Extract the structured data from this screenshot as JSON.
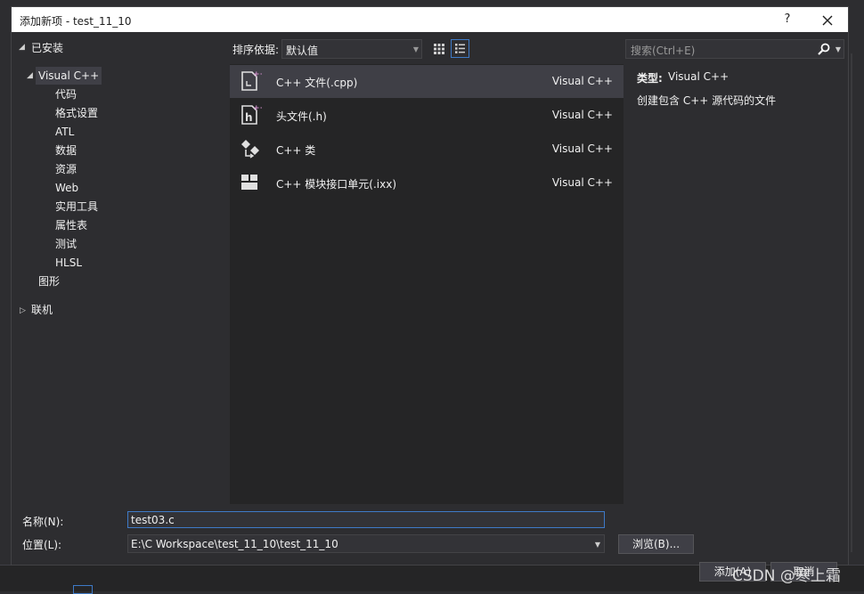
{
  "window": {
    "title": "添加新项 - test_11_10",
    "help_label": "?",
    "close_label": "✕"
  },
  "tree": {
    "installed": "已安装",
    "visual_cpp": "Visual C++",
    "children": [
      "代码",
      "格式设置",
      "ATL",
      "数据",
      "资源",
      "Web",
      "实用工具",
      "属性表",
      "测试",
      "HLSL"
    ],
    "graphics": "图形",
    "online": "联机"
  },
  "toolbar": {
    "sort_label": "排序依据:",
    "sort_value": "默认值"
  },
  "templates": [
    {
      "name": "C++ 文件(.cpp)",
      "lang": "Visual C++",
      "icon": "cpp-file-icon"
    },
    {
      "name": "头文件(.h)",
      "lang": "Visual C++",
      "icon": "header-file-icon"
    },
    {
      "name": "C++ 类",
      "lang": "Visual C++",
      "icon": "cpp-class-icon"
    },
    {
      "name": "C++ 模块接口单元(.ixx)",
      "lang": "Visual C++",
      "icon": "module-unit-icon"
    }
  ],
  "search": {
    "placeholder": "搜索(Ctrl+E)"
  },
  "details": {
    "type_label": "类型:",
    "type_value": "Visual C++",
    "description": "创建包含 C++ 源代码的文件"
  },
  "form": {
    "name_label": "名称(N):",
    "name_value": "test03.c",
    "location_label": "位置(L):",
    "location_value": "E:\\C Workspace\\test_11_10\\test_11_10",
    "browse_label": "浏览(B)...",
    "add_label": "添加(A)",
    "cancel_label": "取消"
  },
  "watermark": "CSDN @寒上霜",
  "colors": {
    "accent": "#3e7ac7",
    "background": "#2d2d30",
    "panel": "#252526",
    "selected": "#3f3f46"
  }
}
